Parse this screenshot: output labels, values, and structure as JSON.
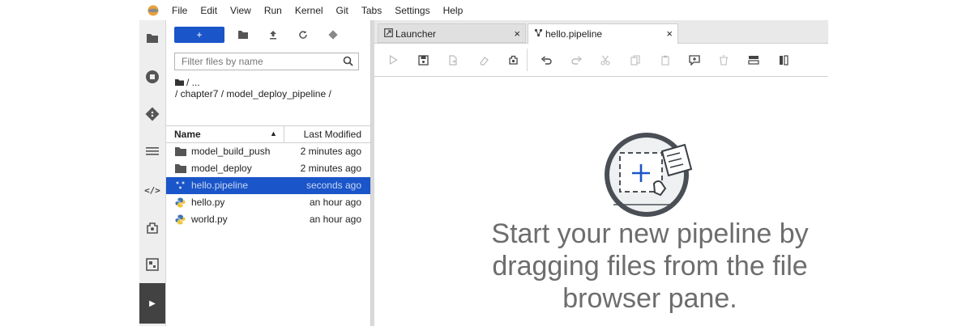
{
  "menu": [
    "File",
    "Edit",
    "View",
    "Run",
    "Kernel",
    "Git",
    "Tabs",
    "Settings",
    "Help"
  ],
  "file_browser": {
    "new_label": "+",
    "search_placeholder": "Filter files by name",
    "breadcrumb_root": "/ ...",
    "breadcrumb_path": "/ chapter7 / model_deploy_pipeline /",
    "header_name": "Name",
    "header_modified": "Last Modified",
    "items": [
      {
        "name": "model_build_push",
        "modified": "2 minutes ago",
        "type": "folder"
      },
      {
        "name": "model_deploy",
        "modified": "2 minutes ago",
        "type": "folder"
      },
      {
        "name": "hello.pipeline",
        "modified": "seconds ago",
        "type": "pipeline",
        "selected": true
      },
      {
        "name": "hello.py",
        "modified": "an hour ago",
        "type": "python"
      },
      {
        "name": "world.py",
        "modified": "an hour ago",
        "type": "python"
      }
    ]
  },
  "tabs": [
    {
      "label": "Launcher",
      "close": "×"
    },
    {
      "label": "hello.pipeline",
      "close": "×"
    }
  ],
  "canvas": {
    "hint_line1": "Start your new pipeline by",
    "hint_line2": "dragging files from the file",
    "hint_line3": "browser pane."
  },
  "colors": {
    "accent": "#1a55c9",
    "activity_bg": "#eeeeee",
    "hint_text": "#6d6d6d"
  }
}
